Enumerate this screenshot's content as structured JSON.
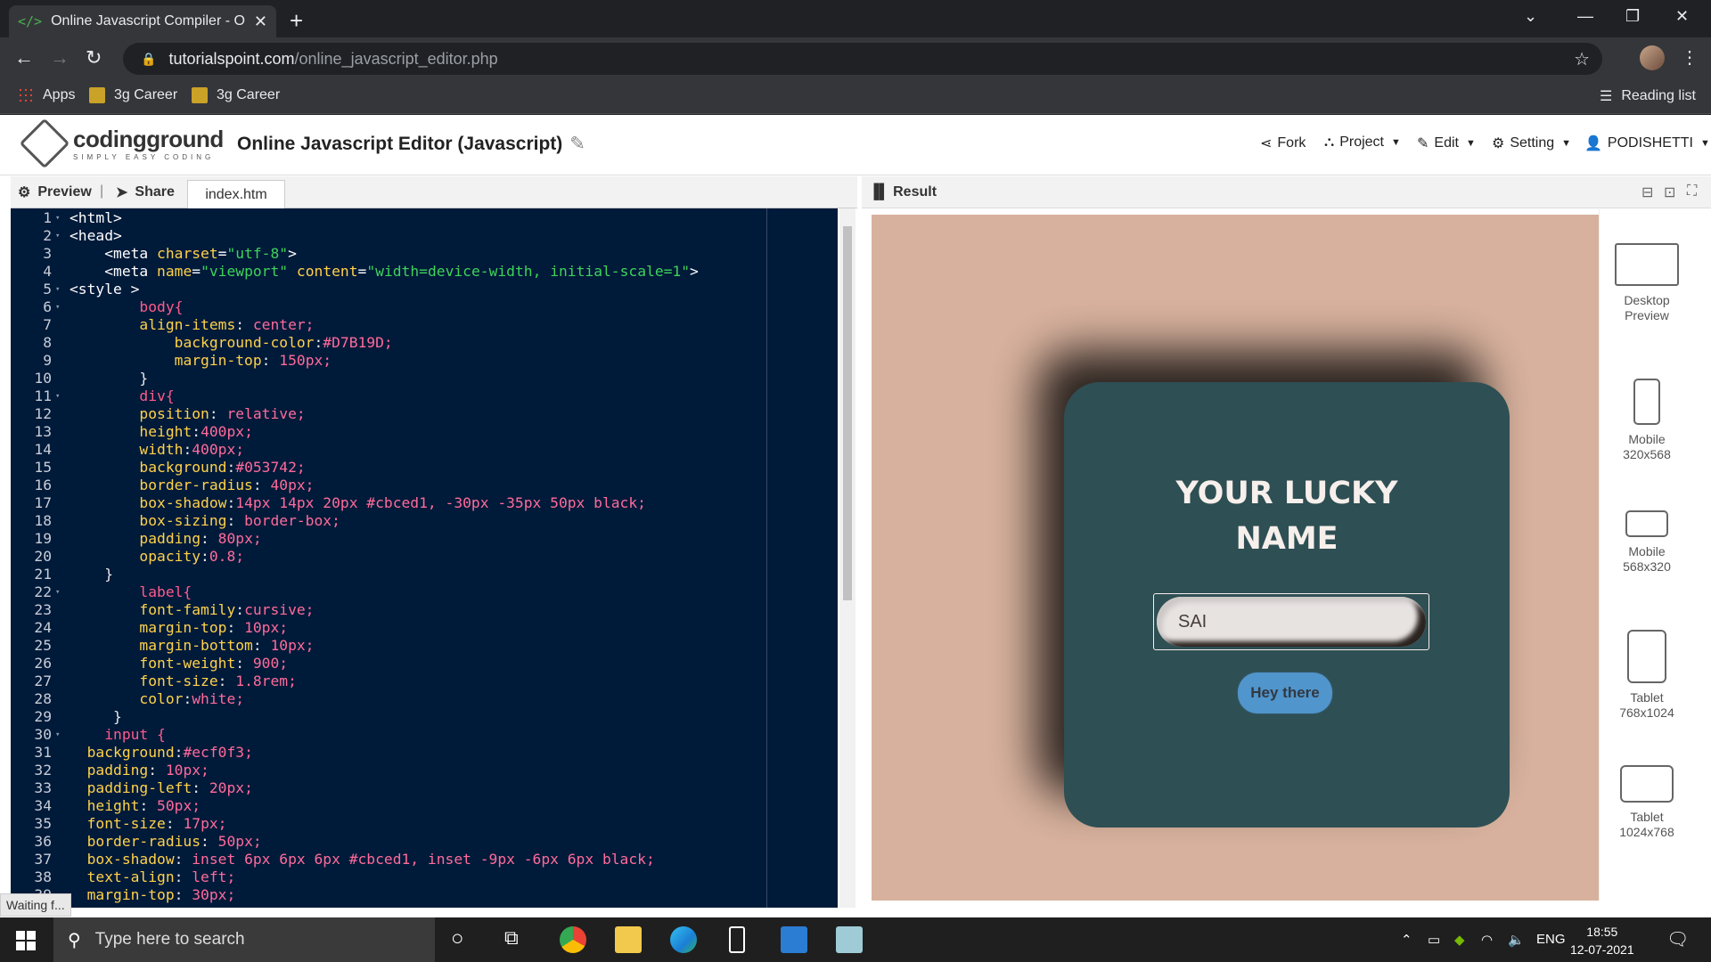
{
  "browser": {
    "tab_title": "Online Javascript Compiler - Onli",
    "url_host": "tutorialspoint.com",
    "url_path": "/online_javascript_editor.php",
    "bookmarks": [
      "Apps",
      "3g Career",
      "3g Career"
    ],
    "reading_list": "Reading list"
  },
  "header": {
    "logo_main": "codingground",
    "logo_sub": "SIMPLY EASY CODING",
    "title": "Online Javascript Editor (Javascript)",
    "menu": [
      "Fork",
      "Project",
      "Edit",
      "Setting",
      "PODISHETTI"
    ]
  },
  "editor": {
    "preview_label": "Preview",
    "share_label": "Share",
    "file_tab": "index.htm",
    "lines": [
      "<html>",
      "<head>",
      "    <meta charset=\"utf-8\">",
      "    <meta name=\"viewport\" content=\"width=device-width, initial-scale=1\">",
      "<style >",
      "        body{",
      "        align-items: center;",
      "            background-color:#D7B19D;",
      "            margin-top: 150px;",
      "        }",
      "        div{",
      "        position: relative;",
      "        height:400px;",
      "        width:400px;",
      "        background:#053742;",
      "        border-radius: 40px;",
      "        box-shadow:14px 14px 20px #cbced1, -30px -35px 50px black;",
      "        box-sizing: border-box;",
      "        padding: 80px;",
      "        opacity:0.8;",
      "    }",
      "        label{",
      "        font-family:cursive;",
      "        margin-top: 10px;",
      "        margin-bottom: 10px;",
      "        font-weight: 900;",
      "        font-size: 1.8rem;",
      "        color:white;",
      "     }",
      "    input {",
      "  background:#ecf0f3;",
      "  padding: 10px;",
      "  padding-left: 20px;",
      "  height: 50px;",
      "  font-size: 17px;",
      "  border-radius: 50px;",
      "  box-shadow: inset 6px 6px 6px #cbced1, inset -9px -6px 6px black;",
      "  text-align: left;",
      "  margin-top: 30px;"
    ],
    "status": "Waiting f..."
  },
  "result": {
    "label": "Result",
    "card_label_line1": "YOUR LUCKY",
    "card_label_line2": "NAME",
    "input_value": "SAI",
    "button_label": "Hey there",
    "devices": [
      {
        "name": "Desktop",
        "size": "Preview"
      },
      {
        "name": "Mobile",
        "size": "320x568"
      },
      {
        "name": "Mobile",
        "size": "568x320"
      },
      {
        "name": "Tablet",
        "size": "768x1024"
      },
      {
        "name": "Tablet",
        "size": "1024x768"
      }
    ]
  },
  "taskbar": {
    "search_placeholder": "Type here to search",
    "lang": "ENG",
    "time": "18:55",
    "date": "12-07-2021"
  },
  "colors": {
    "editor_bg": "#001a3a",
    "preview_bg": "#D7B19D",
    "card_bg": "#053742",
    "button_bg": "#2f8fd8"
  }
}
